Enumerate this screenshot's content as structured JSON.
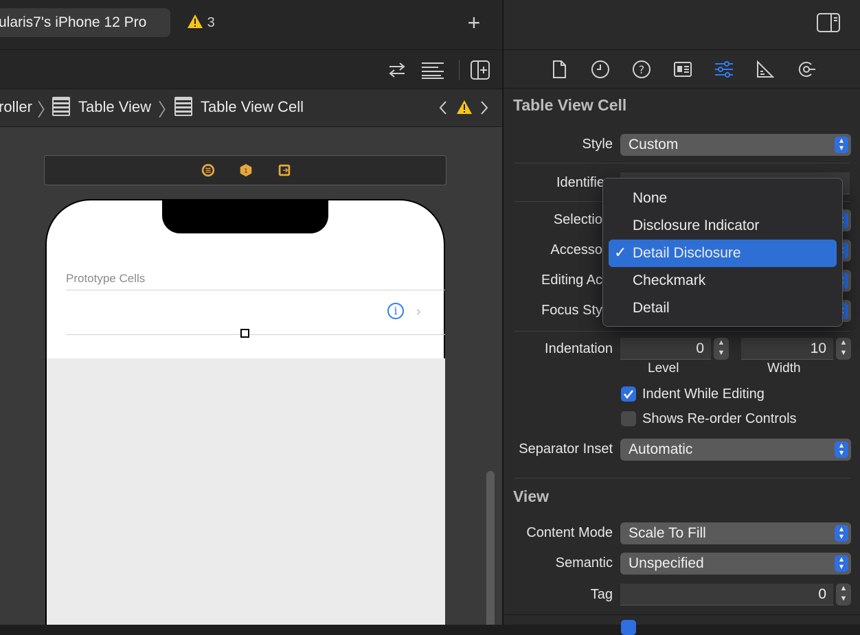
{
  "toolbar": {
    "run_destination": "ularis7's iPhone 12 Pro",
    "warning_count": "3",
    "add_label": "+"
  },
  "breadcrumb": {
    "items": [
      "roller",
      "Table View",
      "Table View Cell"
    ]
  },
  "canvas": {
    "section_header": "Prototype Cells"
  },
  "inspector": {
    "section_title": "Table View Cell",
    "style_label": "Style",
    "style_value": "Custom",
    "identifier_label": "Identifie",
    "selection_label": "Selectio",
    "accessory_label": "Accesso",
    "editing_acc_label": "Editing Ac",
    "focus_style_label": "Focus Sty",
    "indentation_label": "Indentation",
    "indent_level_value": "0",
    "indent_width_value": "10",
    "level_caption": "Level",
    "width_caption": "Width",
    "indent_while_editing_label": "Indent While Editing",
    "shows_reorder_label": "Shows Re-order Controls",
    "separator_inset_label": "Separator Inset",
    "separator_inset_value": "Automatic",
    "view_section_title": "View",
    "content_mode_label": "Content Mode",
    "content_mode_value": "Scale To Fill",
    "semantic_label": "Semantic",
    "semantic_value": "Unspecified",
    "tag_label": "Tag",
    "tag_value": "0",
    "indent_while_editing_checked": true,
    "shows_reorder_checked": false
  },
  "accessory_menu": {
    "options": [
      "None",
      "Disclosure Indicator",
      "Detail Disclosure",
      "Checkmark",
      "Detail"
    ],
    "selected": "Detail Disclosure",
    "checkmark": "✓"
  },
  "colors": {
    "accent": "#2f6fe0",
    "warning": "#f5c518",
    "info_blue": "#2f7cf6"
  }
}
